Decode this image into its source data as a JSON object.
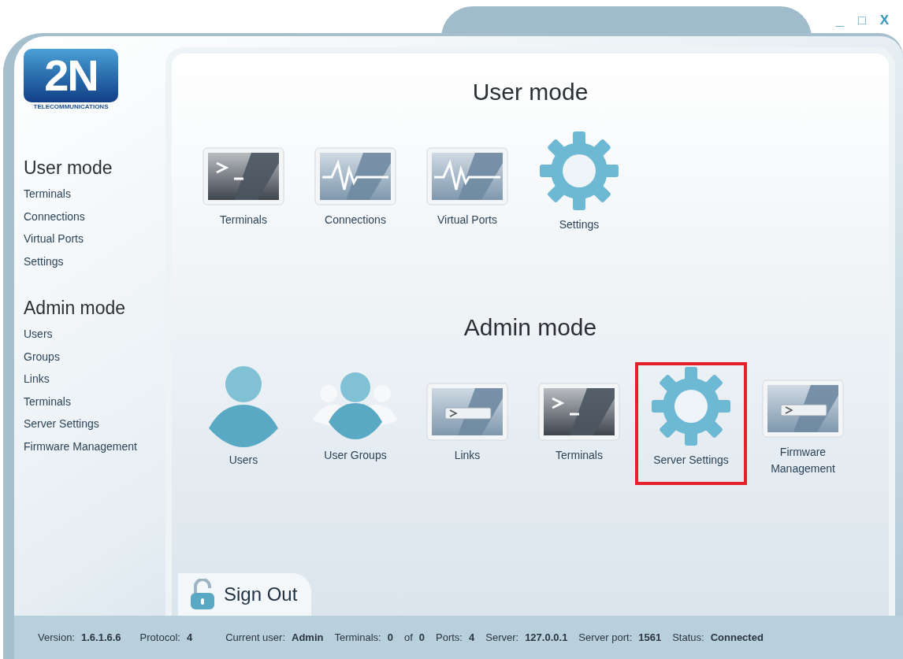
{
  "window_controls": [
    {
      "kind": "minimize",
      "label": "_"
    },
    {
      "kind": "maximize",
      "label": "□"
    },
    {
      "kind": "close",
      "label": "X"
    }
  ],
  "logo": {
    "mark": "2N",
    "tagline": "TELECOMMUNICATIONS"
  },
  "sidebar": {
    "sections": [
      {
        "title": "User mode",
        "items": [
          "Terminals",
          "Connections",
          "Virtual Ports",
          "Settings"
        ]
      },
      {
        "title": "Admin mode",
        "items": [
          "Users",
          "Groups",
          "Links",
          "Terminals",
          "Server Settings",
          "Firmware Management"
        ]
      }
    ]
  },
  "main": {
    "sections": [
      {
        "title": "User mode",
        "tiles": [
          {
            "kind": "terminal",
            "label": "Terminals",
            "selected": false
          },
          {
            "kind": "pulse",
            "label": "Connections",
            "selected": false
          },
          {
            "kind": "pulse",
            "label": "Virtual Ports",
            "selected": false
          },
          {
            "kind": "gear",
            "label": "Settings",
            "selected": false
          }
        ]
      },
      {
        "title": "Admin mode",
        "tiles": [
          {
            "kind": "user",
            "label": "Users",
            "selected": false
          },
          {
            "kind": "group",
            "label": "User Groups",
            "selected": false
          },
          {
            "kind": "prompt",
            "label": "Links",
            "selected": false
          },
          {
            "kind": "terminal",
            "label": "Terminals",
            "selected": false
          },
          {
            "kind": "gear",
            "label": "Server Settings",
            "selected": true
          },
          {
            "kind": "prompt",
            "label": "Firmware Management",
            "selected": false
          }
        ]
      }
    ]
  },
  "sign_out": {
    "label": "Sign Out"
  },
  "status_bar": [
    {
      "label": "Version:",
      "value": "1.6.1.6.6"
    },
    {
      "label": "Protocol:",
      "value": "4"
    },
    {
      "label": "Current user:",
      "value": "Admin"
    },
    {
      "label": "Terminals:",
      "value": "0"
    },
    {
      "label": "of",
      "value": "0"
    },
    {
      "label": "Ports:",
      "value": "4"
    },
    {
      "label": "Server:",
      "value": "127.0.0.1"
    },
    {
      "label": "Server port:",
      "value": "1561"
    },
    {
      "label": "Status:",
      "value": "Connected"
    }
  ]
}
